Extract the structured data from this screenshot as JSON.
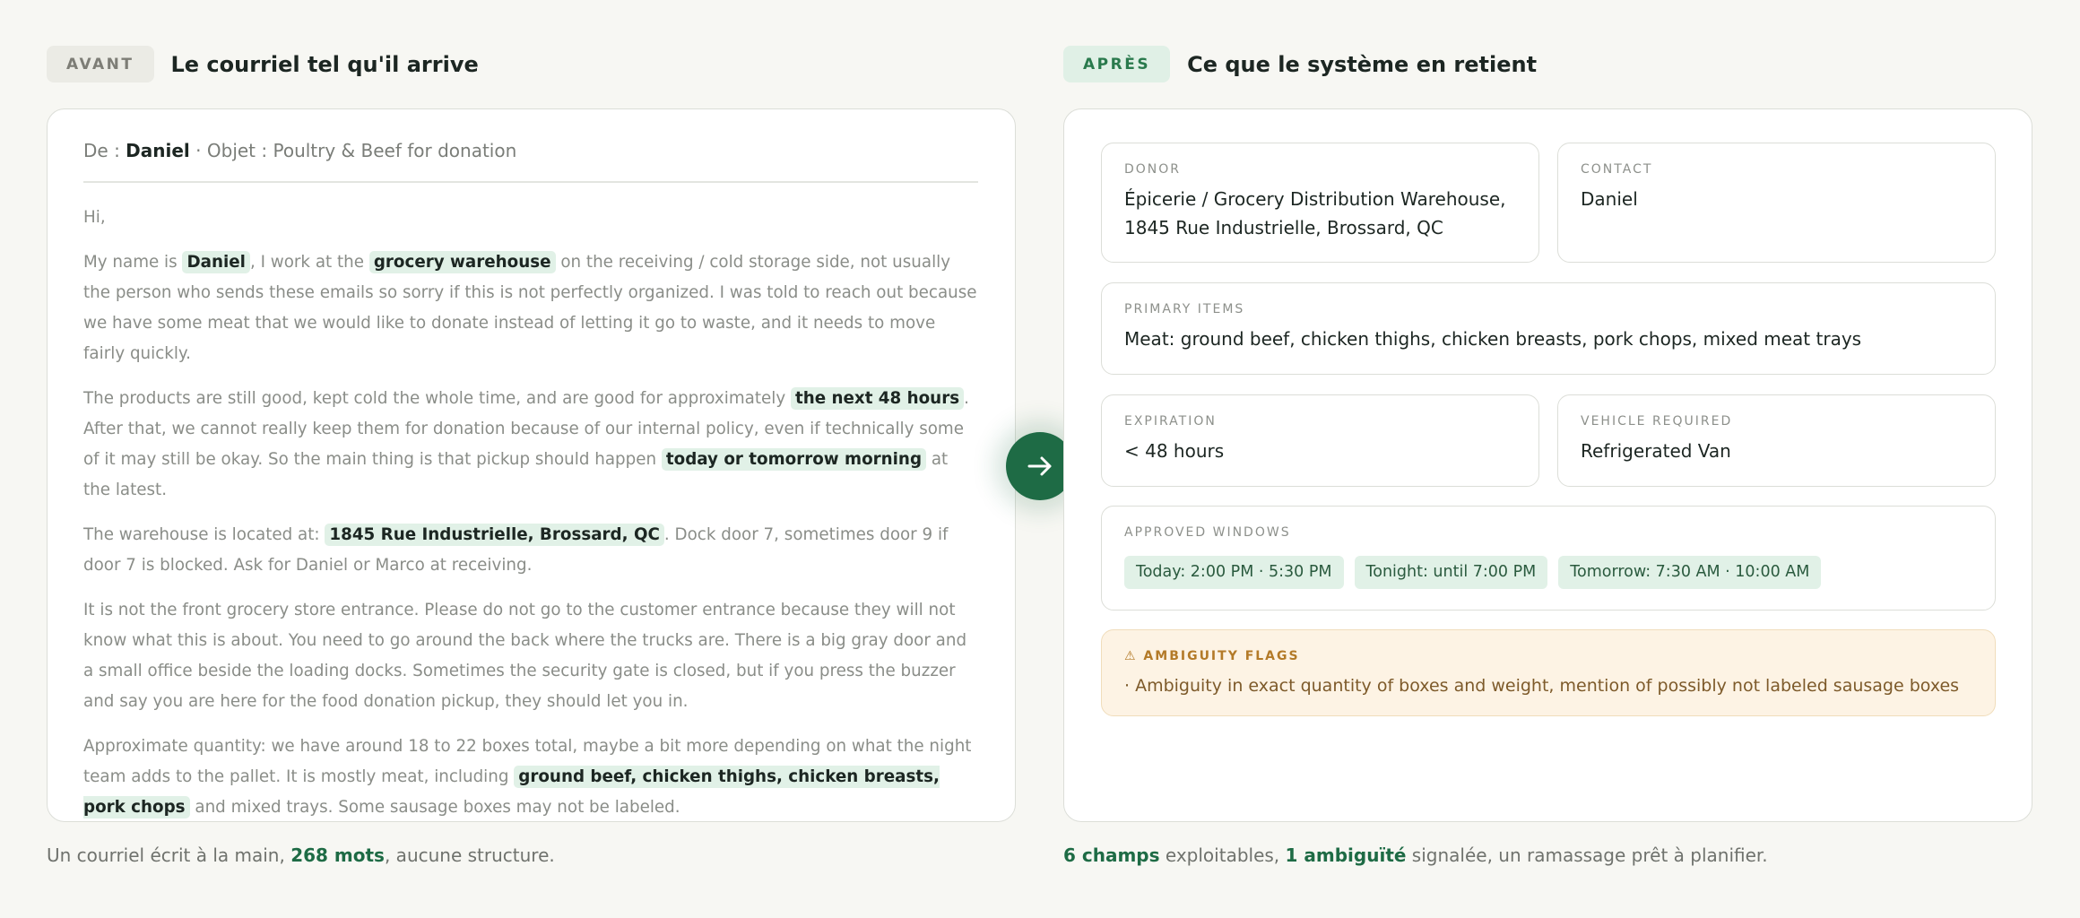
{
  "left": {
    "tag": "AVANT",
    "title": "Le courriel tel qu'il arrive",
    "mail": {
      "from_label": "De :",
      "from_name": "Daniel",
      "subject_sep": "·",
      "subject_label": "Objet :",
      "subject": "Poultry & Beef for donation"
    },
    "footer": {
      "pre": "Un courriel écrit à la main,",
      "highlight": "268 mots",
      "post": ", aucune structure."
    }
  },
  "email_paragraphs": [
    [
      {
        "t": "Hi,"
      }
    ],
    [
      {
        "t": "My name is "
      },
      {
        "t": "Daniel",
        "hl": true
      },
      {
        "t": ", I work at the "
      },
      {
        "t": "grocery warehouse",
        "hl": true
      },
      {
        "t": " on the receiving / cold storage side, not usually the person who sends these emails so sorry if this is not perfectly organized. I was told to reach out because we have some meat that we would like to donate instead of letting it go to waste, and it needs to move fairly quickly."
      }
    ],
    [
      {
        "t": "The products are still good, kept cold the whole time, and are good for approximately "
      },
      {
        "t": "the next 48 hours",
        "hl": true
      },
      {
        "t": ". After that, we cannot really keep them for donation because of our internal policy, even if technically some of it may still be okay. So the main thing is that pickup should happen "
      },
      {
        "t": "today or tomorrow morning",
        "hl": true
      },
      {
        "t": " at the latest."
      }
    ],
    [
      {
        "t": "The warehouse is located at: "
      },
      {
        "t": "1845 Rue Industrielle, Brossard, QC",
        "hl": true
      },
      {
        "t": ". Dock door 7, sometimes door 9 if door 7 is blocked. Ask for Daniel or Marco at receiving."
      }
    ],
    [
      {
        "t": "It is not the front grocery store entrance. Please do not go to the customer entrance because they will not know what this is about. You need to go around the back where the trucks are. There is a big gray door and a small office beside the loading docks. Sometimes the security gate is closed, but if you press the buzzer and say you are here for the food donation pickup, they should let you in."
      }
    ],
    [
      {
        "t": "Approximate quantity: we have around 18 to 22 boxes total, maybe a bit more depending on what the night team adds to the pallet. It is mostly meat, including "
      },
      {
        "t": "ground beef, chicken thighs, chicken breasts, pork chops",
        "hl": true
      },
      {
        "t": " and mixed trays. Some sausage boxes may not be labeled."
      }
    ]
  ],
  "right": {
    "tag": "APRÈS",
    "title": "Ce que le système en retient",
    "donor": {
      "label": "DONOR",
      "line1": "Épicerie / Grocery Distribution Warehouse,",
      "line2": "1845 Rue Industrielle, Brossard, QC"
    },
    "contact": {
      "label": "CONTACT",
      "value": "Daniel"
    },
    "primary_items": {
      "label": "PRIMARY ITEMS",
      "value": "Meat: ground beef, chicken thighs, chicken breasts, pork chops, mixed meat trays"
    },
    "expiration": {
      "label": "EXPIRATION",
      "value": "< 48 hours"
    },
    "vehicle": {
      "label": "VEHICLE REQUIRED",
      "value": "Refrigerated Van"
    },
    "windows": {
      "label": "APPROVED WINDOWS",
      "items": [
        "Today: 2:00 PM · 5:30 PM",
        "Tonight: until 7:00 PM",
        "Tomorrow: 7:30 AM · 10:00 AM"
      ]
    },
    "flags": {
      "label": "⚠ AMBIGUITY FLAGS",
      "value": "· Ambiguity in exact quantity of boxes and weight, mention of possibly not labeled sausage boxes"
    },
    "footer": {
      "h1": "6 champs",
      "mid": " exploitables, ",
      "h2": "1 ambiguïté",
      "post": " signalée, un ramassage prêt à planifier."
    }
  },
  "icons": {
    "arrow": "arrow-right-icon"
  },
  "colors": {
    "accent": "#1e6b45",
    "highlight": "#e1f1e7",
    "flag_bg": "#fdf3e4"
  }
}
